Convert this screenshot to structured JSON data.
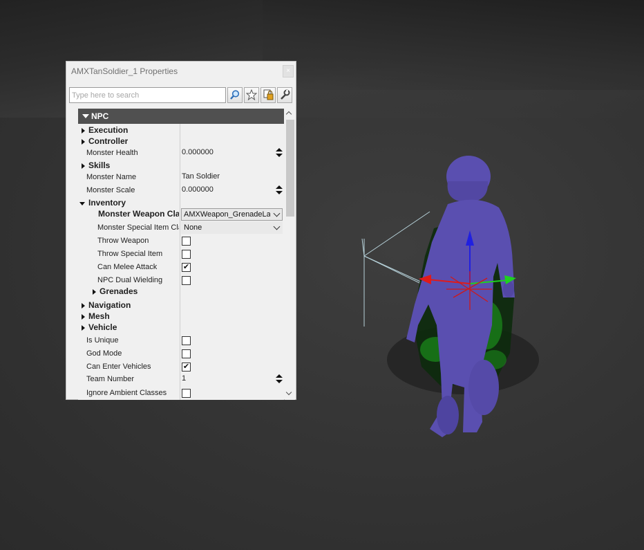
{
  "window": {
    "title": "AMXTanSoldier_1 Properties",
    "close_label": "×"
  },
  "search": {
    "placeholder": "Type here to search",
    "value": ""
  },
  "toolbar": {
    "buttons": [
      {
        "icon": "magnifier-icon"
      },
      {
        "icon": "star-icon"
      },
      {
        "icon": "copy-lock-icon"
      },
      {
        "icon": "wrench-icon"
      }
    ]
  },
  "section": {
    "label": "NPC"
  },
  "rows": {
    "execution": "Execution",
    "controller": "Controller",
    "monster_health": {
      "label": "Monster Health",
      "value": "0.000000"
    },
    "skills": "Skills",
    "monster_name": {
      "label": "Monster Name",
      "value": "Tan Soldier"
    },
    "monster_scale": {
      "label": "Monster Scale",
      "value": "0.000000"
    },
    "inventory": "Inventory",
    "weapon_class": {
      "label": "Monster Weapon Cla",
      "value": "AMXWeapon_GrenadeLau"
    },
    "special_item_class": {
      "label": "Monster Special Item Cla",
      "value": "None"
    },
    "throw_weapon": {
      "label": "Throw Weapon",
      "checked": false
    },
    "throw_special_item": {
      "label": "Throw Special Item",
      "checked": false
    },
    "can_melee_attack": {
      "label": "Can Melee Attack",
      "checked": true
    },
    "npc_dual_wielding": {
      "label": "NPC Dual Wielding",
      "checked": false
    },
    "grenades": "Grenades",
    "navigation": "Navigation",
    "mesh": "Mesh",
    "vehicle": "Vehicle",
    "is_unique": {
      "label": "Is Unique",
      "checked": false
    },
    "god_mode": {
      "label": "God Mode",
      "checked": false
    },
    "can_enter_vehicles": {
      "label": "Can Enter Vehicles",
      "checked": true
    },
    "team_number": {
      "label": "Team Number",
      "value": "1"
    },
    "ignore_ambient_classes": {
      "label": "Ignore Ambient Classes",
      "checked": false
    }
  },
  "check_glyph": "✔",
  "colors": {
    "section_header": "#505050",
    "soldier": "#5a4fb0",
    "selection_glow": "#1fa81f",
    "gizmo_x": "#e01a1a",
    "gizmo_y": "#1fd01f",
    "gizmo_z": "#2020e0"
  }
}
